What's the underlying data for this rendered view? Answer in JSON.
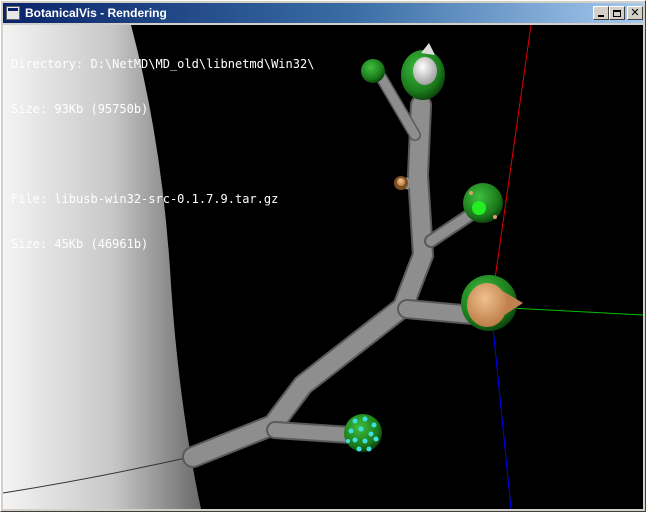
{
  "window": {
    "title": "BotanicalVis - Rendering",
    "icon": "app-icon",
    "controls": {
      "minimize": "minimize-icon",
      "maximize": "maximize-icon",
      "close": "close-icon"
    }
  },
  "info": {
    "directory_line": "Directory: D:\\NetMD\\MD_old\\libnetmd\\Win32\\",
    "directory_size_line": "Size: 93Kb (95750b)",
    "file_line": "File: libusb-win32-src-0.1.7.9.tar.gz",
    "file_size_line": "Size: 45Kb (46961b)"
  },
  "scene": {
    "background": "#000000",
    "trunk_color": "#8a8a8a",
    "leaf_color": "#1f8a1f",
    "fruit_color": "#d8a070",
    "axis_colors": {
      "x": "#00c000",
      "y": "#e00000",
      "z": "#0000ff"
    }
  }
}
